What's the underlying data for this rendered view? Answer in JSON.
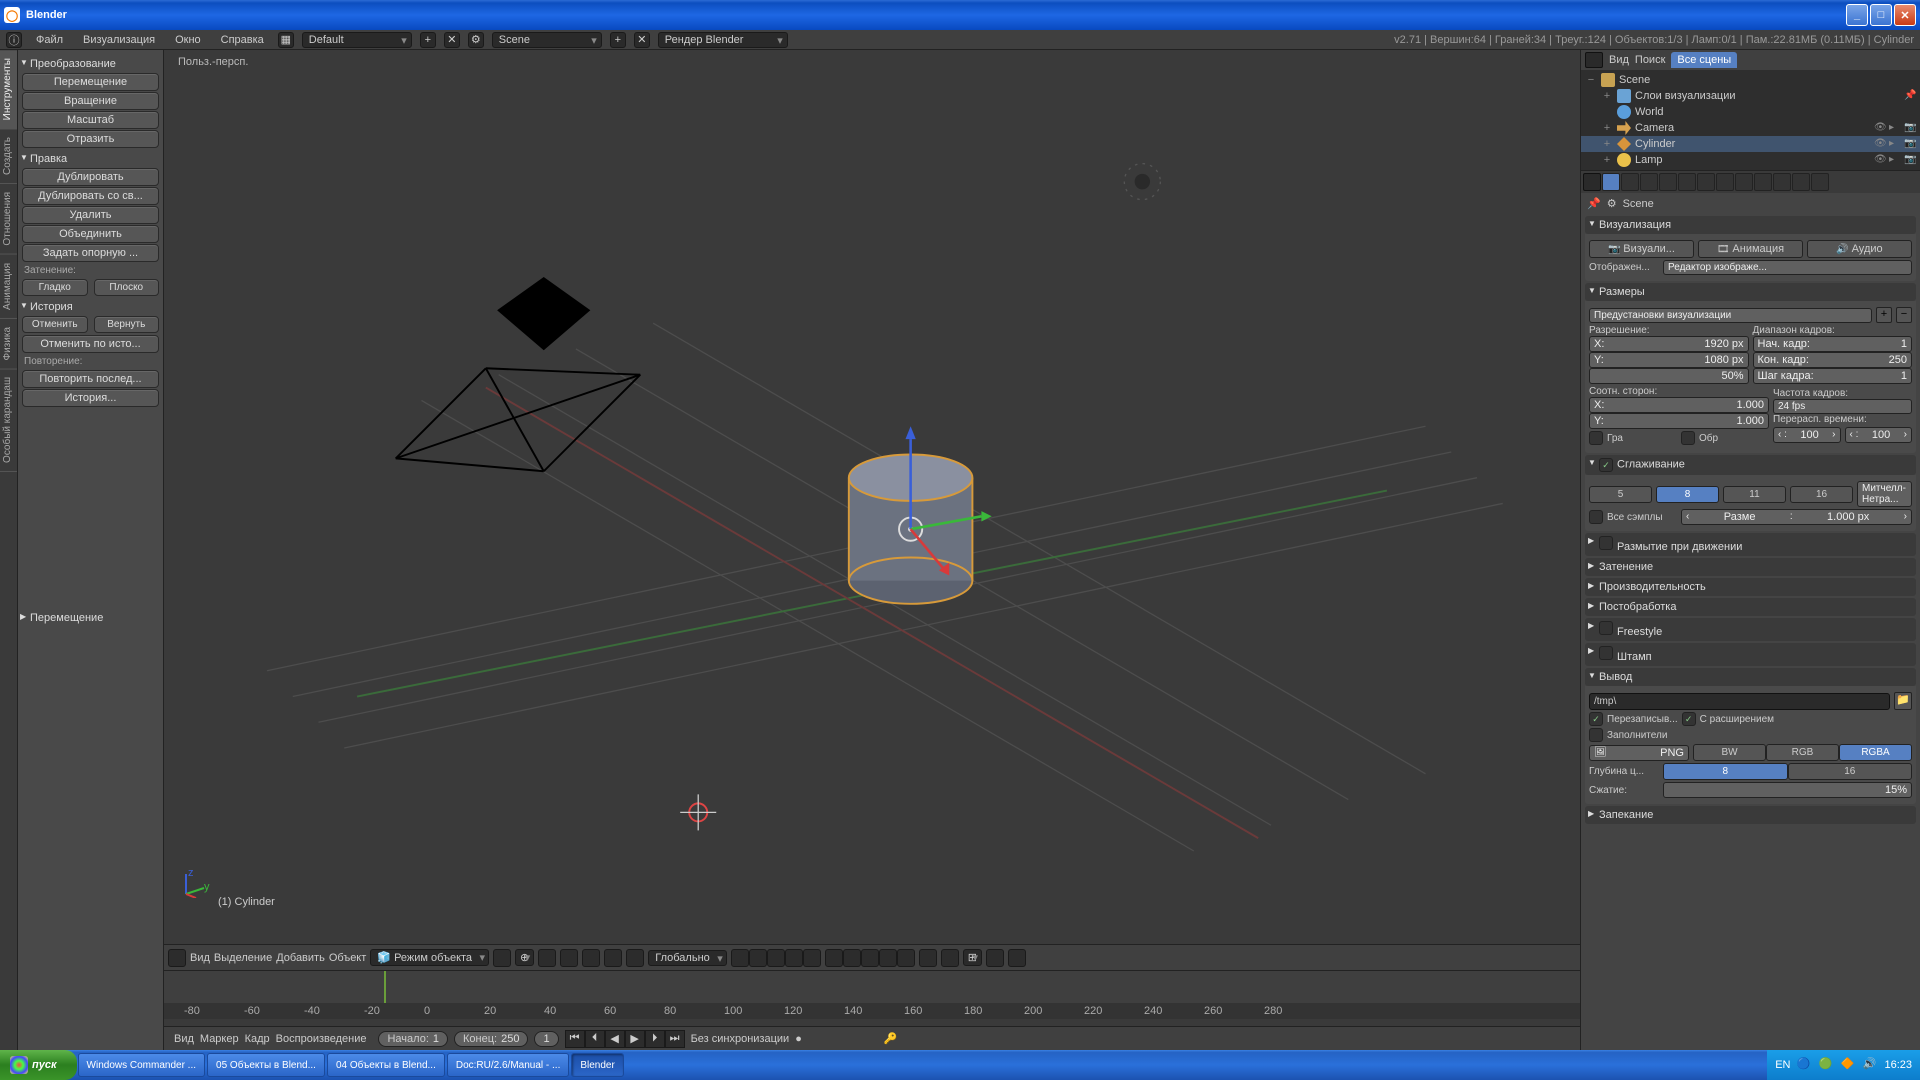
{
  "window": {
    "title": "Blender"
  },
  "info_header": {
    "menus": [
      "Файл",
      "Визуализация",
      "Окно",
      "Справка"
    ],
    "screen_layout": "Default",
    "scene": "Scene",
    "render_engine": "Рендер Blender",
    "stats": "v2.71 | Вершин:64 | Граней:34 | Треуг.:124 | Объектов:1/3 | Ламп:0/1 | Пам.:22.81МБ (0.11МБ) | Cylinder"
  },
  "left_tabs": [
    "Инструменты",
    "Создать",
    "Отношения",
    "Анимация",
    "Физика",
    "Особый карандаш"
  ],
  "tools": {
    "transform_h": "Преобразование",
    "translate": "Перемещение",
    "rotate": "Вращение",
    "scale": "Масштаб",
    "mirror": "Отразить",
    "edit_h": "Правка",
    "duplicate": "Дублировать",
    "duplicate_linked": "Дублировать со св...",
    "delete": "Удалить",
    "join": "Объединить",
    "set_origin": "Задать опорную ...",
    "shading_lbl": "Затенение:",
    "smooth": "Гладко",
    "flat": "Плоско",
    "history_h": "История",
    "undo": "Отменить",
    "redo": "Вернуть",
    "undo_history": "Отменить по исто...",
    "repeat_lbl": "Повторение:",
    "repeat_last": "Повторить послед...",
    "history_btn": "История...",
    "operator_h": "Перемещение"
  },
  "viewport": {
    "persp_label": "Польз.-персп.",
    "object_label": "(1) Cylinder"
  },
  "view3d_header": {
    "menus": [
      "Вид",
      "Выделение",
      "Добавить",
      "Объект"
    ],
    "mode": "Режим объекта",
    "orientation": "Глобально"
  },
  "timeline": {
    "menus": [
      "Вид",
      "Маркер",
      "Кадр",
      "Воспроизведение"
    ],
    "start_lbl": "Начало:",
    "start_val": "1",
    "end_lbl": "Конец:",
    "end_val": "250",
    "cur_val": "1",
    "sync": "Без синхронизации",
    "ticks": [
      "-80",
      "-60",
      "-40",
      "-20",
      "0",
      "20",
      "40",
      "60",
      "80",
      "100",
      "120",
      "140",
      "160",
      "180",
      "200",
      "220",
      "240",
      "260",
      "280"
    ]
  },
  "outliner": {
    "view": "Вид",
    "search": "Поиск",
    "filter": "Все сцены",
    "items": [
      {
        "name": "Scene",
        "type": "scene",
        "depth": 0,
        "exp": "−",
        "sel": false
      },
      {
        "name": "Слои визуализации",
        "type": "rlayer",
        "depth": 1,
        "exp": "+",
        "sel": false,
        "pin": true
      },
      {
        "name": "World",
        "type": "world",
        "depth": 1,
        "exp": "",
        "sel": false
      },
      {
        "name": "Camera",
        "type": "cam",
        "depth": 1,
        "exp": "+",
        "sel": false,
        "vis": true
      },
      {
        "name": "Cylinder",
        "type": "mesh",
        "depth": 1,
        "exp": "+",
        "sel": true,
        "vis": true
      },
      {
        "name": "Lamp",
        "type": "lamp",
        "depth": 1,
        "exp": "+",
        "sel": false,
        "vis": true
      }
    ]
  },
  "props": {
    "crumb": "Scene",
    "render_h": "Визуализация",
    "render_btn": "Визуали...",
    "anim_btn": "Анимация",
    "audio_btn": "Аудио",
    "display_lbl": "Отображен...",
    "display_val": "Редактор изображе...",
    "dim_h": "Размеры",
    "preset": "Предустановки визуализации",
    "res_lbl": "Разрешение:",
    "res_x_lbl": "X:",
    "res_x": "1920 px",
    "res_y_lbl": "Y:",
    "res_y": "1080 px",
    "res_pct": "50%",
    "range_lbl": "Диапазон кадров:",
    "fstart_lbl": "Нач. кадр:",
    "fstart": "1",
    "fend_lbl": "Кон. кадр:",
    "fend": "250",
    "fstep_lbl": "Шаг кадра:",
    "fstep": "1",
    "aspect_lbl": "Соотн. сторон:",
    "asp_x": "1.000",
    "asp_y": "1.000",
    "fps_lbl": "Частота кадров:",
    "fps": "24 fps",
    "remap_lbl": "Перерасп. времени:",
    "remap_old": "100",
    "remap_new": "100",
    "border_lbl": "Гра",
    "crop_lbl": "Обр",
    "aa_h": "Сглаживание",
    "aa_opts": [
      "5",
      "8",
      "11",
      "16"
    ],
    "aa_active": "8",
    "aa_filter": "Митчелл-Нетра...",
    "full_sample": "Все сэмплы",
    "aa_size_lbl": "Разме",
    "aa_size": "1.000 px",
    "mb_h": "Размытие при движении",
    "shading_h": "Затенение",
    "perf_h": "Производительность",
    "post_h": "Постобработка",
    "freestyle_h": "Freestyle",
    "stamp_h": "Штамп",
    "output_h": "Вывод",
    "output_path": "/tmp\\",
    "overwrite": "Перезаписыв...",
    "extensions": "С расширением",
    "placeholders": "Заполнители",
    "format": "PNG",
    "color_modes": [
      "BW",
      "RGB",
      "RGBA"
    ],
    "color_active": "RGBA",
    "depth_lbl": "Глубина ц...",
    "depth_opts": [
      "8",
      "16"
    ],
    "depth_active": "8",
    "compress_lbl": "Сжатие:",
    "compress": "15%",
    "bake_h": "Запекание"
  },
  "taskbar": {
    "start": "пуск",
    "apps": [
      "Windows Commander ...",
      "05 Объекты в Blend...",
      "04 Объекты в Blend...",
      "Doc:RU/2.6/Manual - ...",
      "Blender"
    ],
    "lang": "EN",
    "clock": "16:23"
  }
}
